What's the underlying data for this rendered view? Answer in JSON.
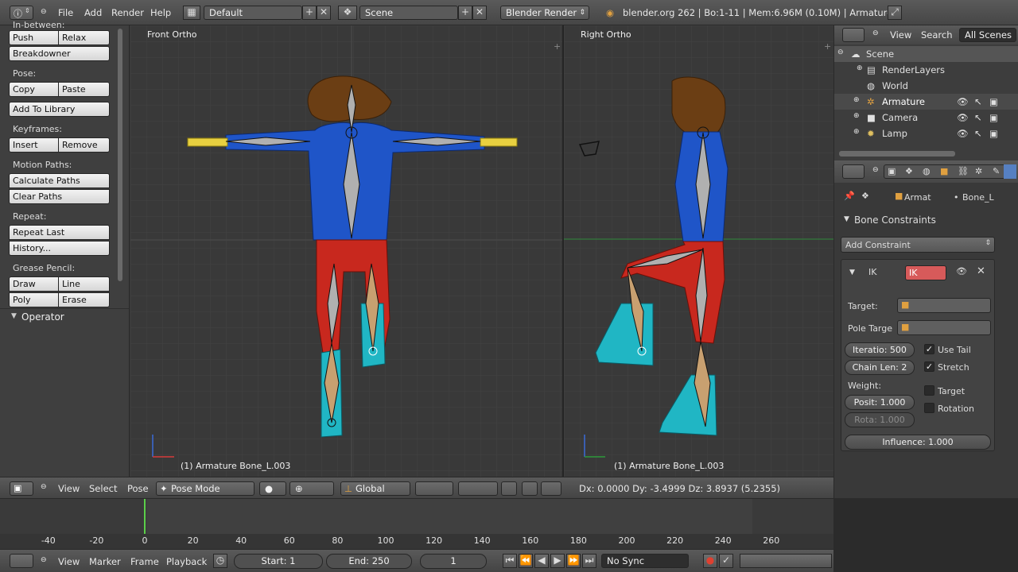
{
  "topbar": {
    "menus": [
      "File",
      "Add",
      "Render",
      "Help"
    ],
    "screen_layout": "Default",
    "scene": "Scene",
    "render_engine": "Blender Render",
    "stats": "blender.org 262 | Bo:1-11 | Mem:6.96M (0.10M) | Armature"
  },
  "toolshelf": {
    "cut_label": "In-between:",
    "push": "Push",
    "relax": "Relax",
    "breakdowner": "Breakdowner",
    "pose_label": "Pose:",
    "copy": "Copy",
    "paste": "Paste",
    "add_to_library": "Add To Library",
    "keyframes_label": "Keyframes:",
    "insert": "Insert",
    "remove": "Remove",
    "motion_paths_label": "Motion Paths:",
    "calculate_paths": "Calculate Paths",
    "clear_paths": "Clear Paths",
    "repeat_label": "Repeat:",
    "repeat_last": "Repeat Last",
    "history": "History...",
    "grease_pencil_label": "Grease Pencil:",
    "draw": "Draw",
    "line": "Line",
    "poly": "Poly",
    "erase": "Erase",
    "operator": "Operator"
  },
  "viewports": {
    "left_title": "Front Ortho",
    "right_title": "Right Ortho",
    "left_status": "(1) Armature Bone_L.003",
    "right_status": "(1) Armature Bone_L.003"
  },
  "vpheader": {
    "view": "View",
    "select": "Select",
    "pose": "Pose",
    "mode": "Pose Mode",
    "orientation": "Global",
    "transform_info": "Dx: 0.0000   Dy: -3.4999  Dz: 3.8937 (5.2355)"
  },
  "outliner": {
    "view": "View",
    "search": "Search",
    "filter": "All Scenes",
    "items": [
      "Scene",
      "RenderLayers",
      "World",
      "Armature",
      "Camera",
      "Lamp"
    ]
  },
  "properties": {
    "breadcrumb_obj": "Armat",
    "breadcrumb_bone": "Bone_L",
    "panel_title": "Bone Constraints",
    "add_constraint": "Add Constraint",
    "constraint_type": "IK",
    "constraint_name": "IK",
    "target_label": "Target:",
    "pole_target_label": "Pole Targe",
    "iterations": "Iteratio: 500",
    "chain_len": "Chain Len: 2",
    "use_tail": "Use Tail",
    "stretch": "Stretch",
    "weight_label": "Weight:",
    "position": "Posit: 1.000",
    "rotation_value": "Rota: 1.000",
    "target_check": "Target",
    "rotation_check": "Rotation",
    "influence": "Influence: 1.000"
  },
  "timeline": {
    "ticks": [
      "-40",
      "-20",
      "0",
      "20",
      "40",
      "60",
      "80",
      "100",
      "120",
      "140",
      "160",
      "180",
      "200",
      "220",
      "240",
      "260"
    ],
    "current_frame": 1
  },
  "tlheader": {
    "view": "View",
    "marker": "Marker",
    "frame": "Frame",
    "playback": "Playback",
    "start": "Start: 1",
    "end": "End: 250",
    "current": "1",
    "sync": "No Sync"
  },
  "colors": {
    "shirt": "#1f55c8",
    "pants": "#c8281e",
    "boots": "#20b6c4",
    "hair": "#6b3e14",
    "selected_bone": "#e8d040"
  }
}
